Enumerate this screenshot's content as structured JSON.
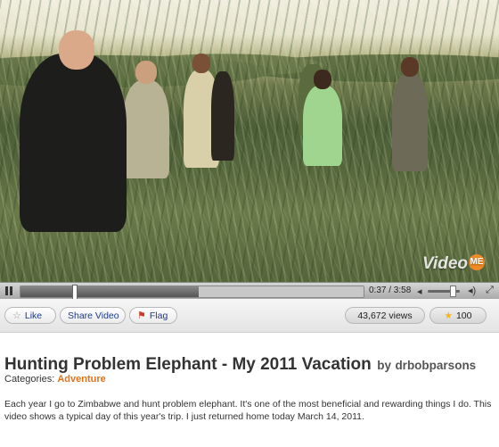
{
  "player": {
    "watermark": "Video",
    "watermark_badge": "ME",
    "time_display": "0:37 / 3:58",
    "progress_fraction": 0.155,
    "loaded_fraction": 0.52,
    "volume_fraction": 0.8
  },
  "actions": {
    "like_label": "Like",
    "share_label": "Share Video",
    "flag_label": "Flag",
    "views": "43,672 views",
    "rating": "100"
  },
  "video_info": {
    "title": "Hunting Problem Elephant - My 2011 Vacation",
    "by": "by",
    "author": "drbobparsons",
    "categories_label": "Categories:",
    "category": "Adventure",
    "description": "Each year I go to Zimbabwe and hunt problem elephant. It's one of the most beneficial and rewarding things I do. This video shows a typical day of this year's trip. I just returned home today March 14, 2011."
  },
  "colors": {
    "accent": "#e2731c",
    "link": "#1a3a8a"
  }
}
